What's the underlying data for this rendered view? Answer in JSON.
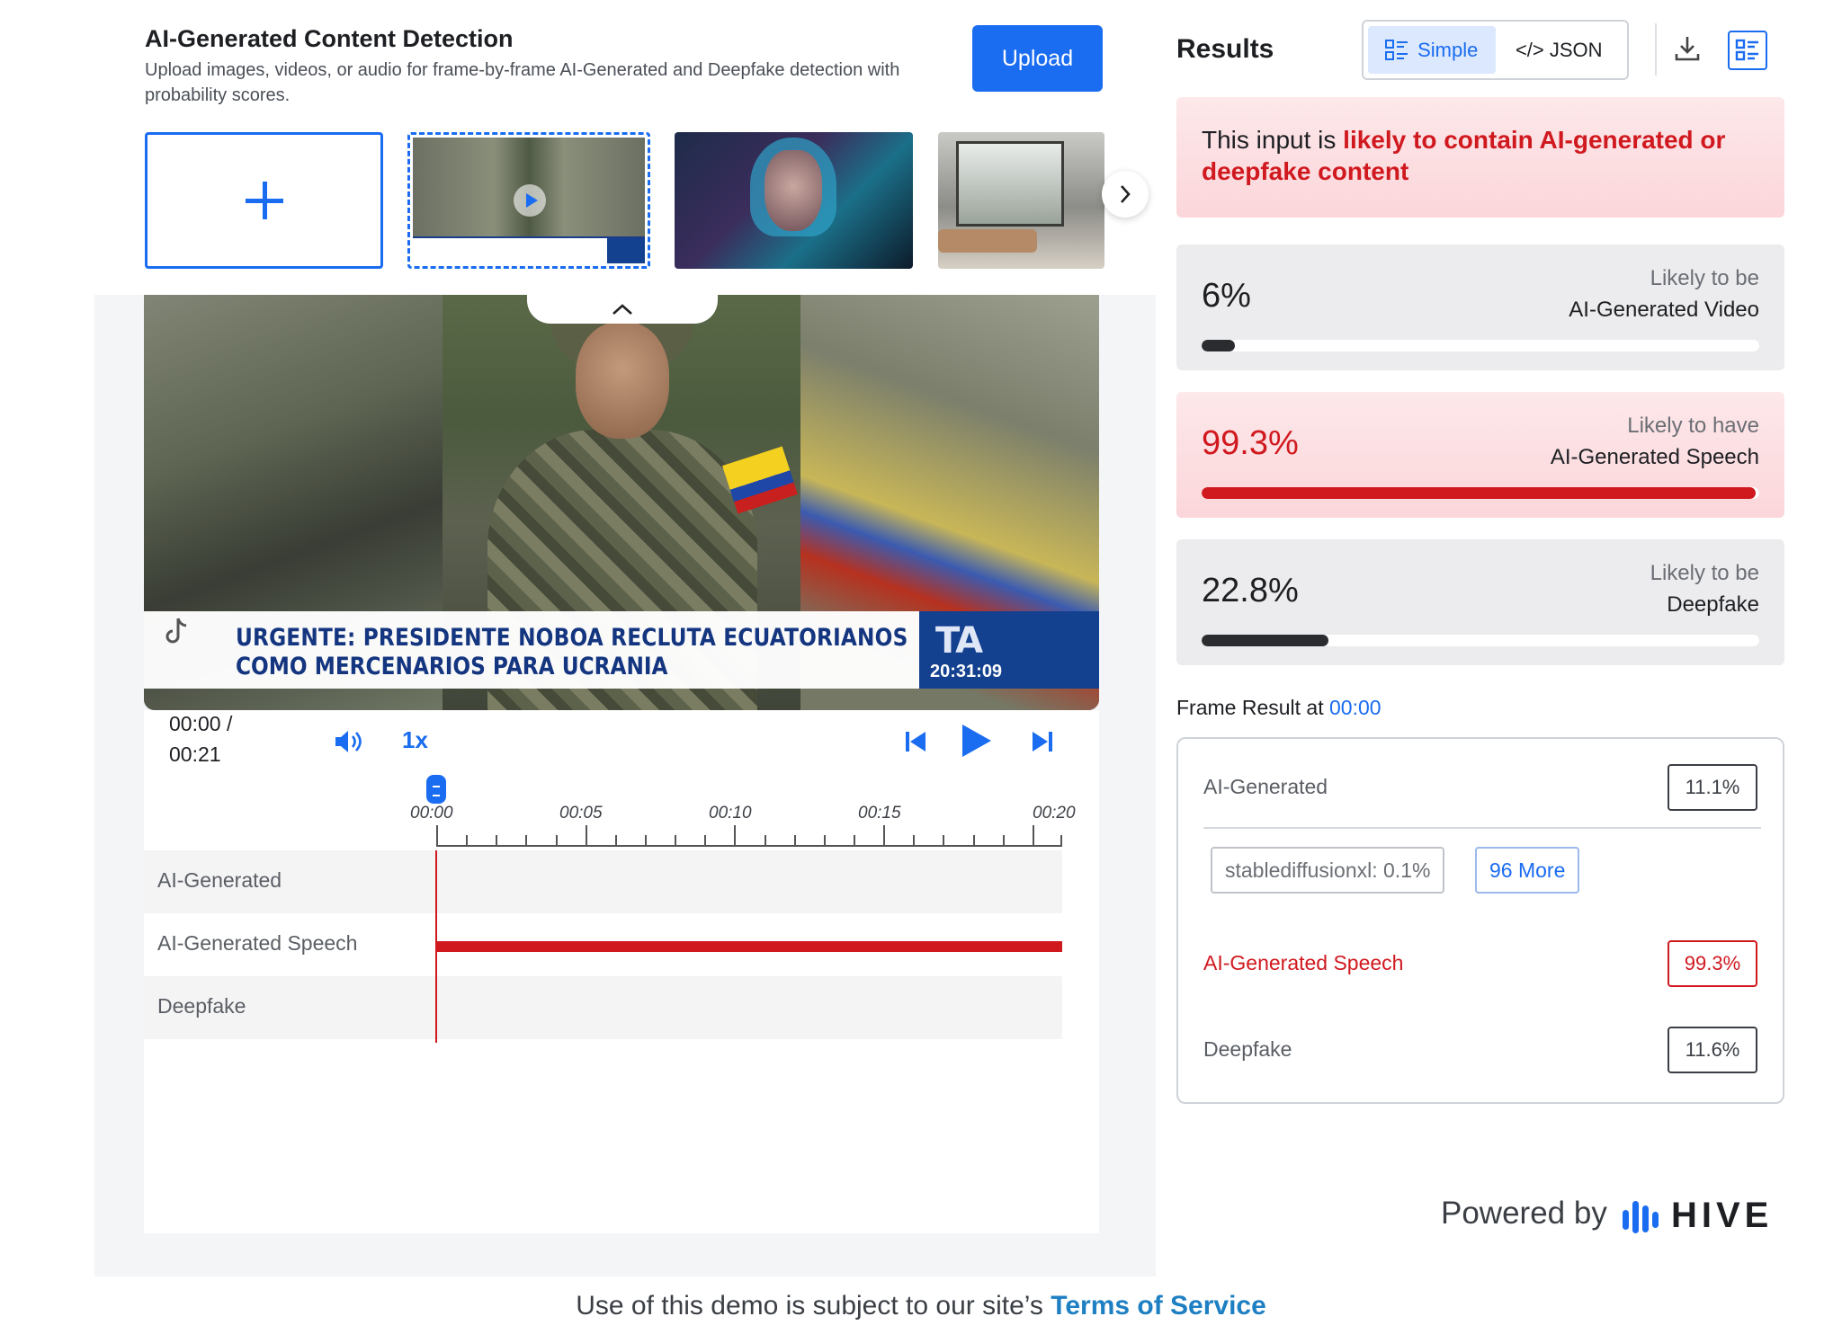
{
  "tool": {
    "title": "AI-Generated Content Detection",
    "description": "Upload images, videos, or audio for frame-by-frame AI-Generated and Deepfake detection with probability scores.",
    "upload_label": "Upload"
  },
  "thumbnails": {
    "add_label": "+",
    "selected_index": 1
  },
  "video": {
    "headline_line1": "URGENTE: PRESIDENTE NOBOA RECLUTA ECUATORIANOS",
    "headline_line2": "COMO MERCENARIOS PARA UCRANIA",
    "brand": "TA",
    "on_screen_time": "20:31:09"
  },
  "player": {
    "current_time": "00:00 /",
    "total_time": "00:21",
    "speed": "1x",
    "progress_fraction": 0
  },
  "timeline": {
    "tick_labels": [
      "00:00",
      "00:05",
      "00:10",
      "00:15",
      "00:20"
    ],
    "tracks": [
      {
        "label": "AI-Generated",
        "active": false
      },
      {
        "label": "AI-Generated Speech",
        "active": true
      },
      {
        "label": "Deepfake",
        "active": false
      }
    ]
  },
  "results": {
    "title": "Results",
    "tab_simple": "Simple",
    "tab_json": "</> JSON",
    "active_tab": "Simple",
    "verdict_prefix": "This input is ",
    "verdict_highlight": "likely to contain AI-generated or deepfake content",
    "scores": [
      {
        "value": "6%",
        "line1": "Likely to be",
        "line2": "AI-Generated Video",
        "fraction": 0.06,
        "alert": false
      },
      {
        "value": "99.3%",
        "line1": "Likely to have",
        "line2": "AI-Generated Speech",
        "fraction": 0.993,
        "alert": true
      },
      {
        "value": "22.8%",
        "line1": "Likely to be",
        "line2": "Deepfake",
        "fraction": 0.228,
        "alert": false
      }
    ]
  },
  "frame_result": {
    "title": "Frame Result at ",
    "time": "00:00",
    "ai_generated_label": "AI-Generated",
    "ai_generated_value": "11.1%",
    "chip_model": "stablediffusionxl: 0.1%",
    "chip_more": "96 More",
    "speech_label": "AI-Generated Speech",
    "speech_value": "99.3%",
    "deepfake_label": "Deepfake",
    "deepfake_value": "11.6%"
  },
  "branding": {
    "powered_by": "Powered by",
    "hive": "HIVE"
  },
  "footer": {
    "text": "Use of this demo is subject to our site’s ",
    "link": "Terms of Service"
  },
  "colors": {
    "accent": "#1a6cf0",
    "alert": "#d0191f"
  }
}
